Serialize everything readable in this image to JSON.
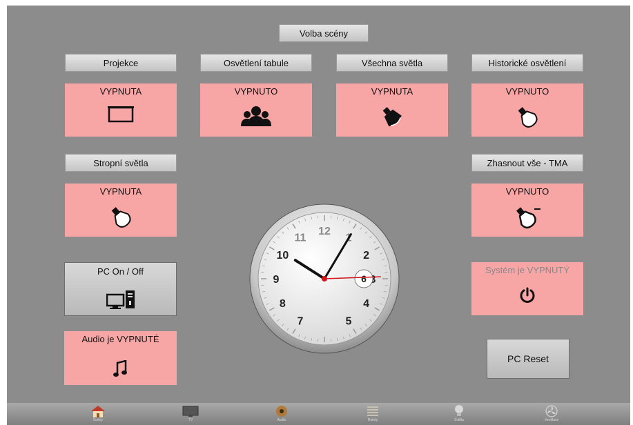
{
  "title": "Volba scény",
  "scenes": [
    {
      "label": "Projekce",
      "status": "VYPNUTA",
      "icon": "projector-screen-icon"
    },
    {
      "label": "Osvětlení tabule",
      "status": "VYPNUTO",
      "icon": "audience-icon"
    },
    {
      "label": "Všechna světla",
      "status": "VYPNUTA",
      "icon": "spotlight-icon"
    },
    {
      "label": "Historické osvětlení",
      "status": "VYPNUTO",
      "icon": "bulb-icon"
    },
    {
      "label": "Stropní světla",
      "status": "VYPNUTA",
      "icon": "bulb-icon"
    },
    {
      "label": "Zhasnout vše - TMA",
      "status": "VYPNUTO",
      "icon": "bulb-off-icon"
    }
  ],
  "pc_button": {
    "label": "PC On / Off",
    "icon": "computer-icon"
  },
  "audio": {
    "status": "Audio je VYPNUTÉ",
    "icon": "music-note-icon"
  },
  "system": {
    "status": "Systém je VYPNUTÝ",
    "icon": "power-icon"
  },
  "reset_button": {
    "label": "PC Reset"
  },
  "clock": {
    "hour": 10,
    "minute": 5,
    "second": 8,
    "date_day": "6",
    "numerals": [
      "12",
      "1",
      "2",
      "3",
      "4",
      "5",
      "6",
      "7",
      "8",
      "9",
      "10",
      "11"
    ]
  },
  "nav": [
    {
      "icon": "home-icon",
      "label": "Scény"
    },
    {
      "icon": "display-icon",
      "label": "TV"
    },
    {
      "icon": "speaker-icon",
      "label": "Audio"
    },
    {
      "icon": "blinds-icon",
      "label": "Rolety"
    },
    {
      "icon": "light-bulb-icon",
      "label": "Světla"
    },
    {
      "icon": "fan-icon",
      "label": "Ventilace"
    }
  ],
  "colors": {
    "background": "#8c8c8c",
    "tile_off": "#f8a5a5",
    "system_text": "#888888"
  }
}
